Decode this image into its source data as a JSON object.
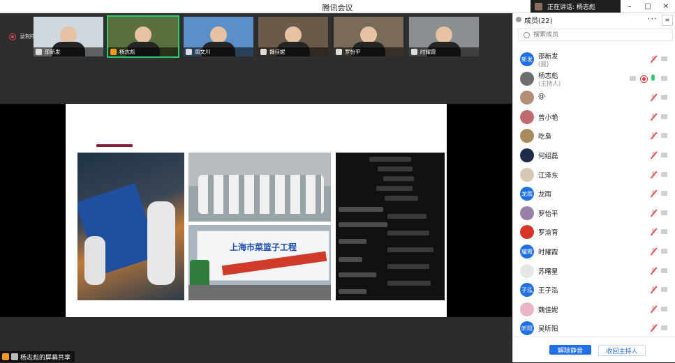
{
  "window": {
    "title": "腾讯会议",
    "speaking": "正在讲话: 杨志彪",
    "controls": {
      "minimize": "–",
      "maximize": "□",
      "close": "✕"
    }
  },
  "recording": {
    "label": "录制中"
  },
  "participants_strip": [
    {
      "name": "邵新发",
      "bg": "#cfd8de",
      "active": false
    },
    {
      "name": "杨志彪",
      "bg": "#5a6f3c",
      "active": true
    },
    {
      "name": "周文川",
      "bg": "#5b8fc7",
      "active": false
    },
    {
      "name": "魏佳妮",
      "bg": "#6b5a4a",
      "active": false
    },
    {
      "name": "罗怡平",
      "bg": "#7a6a5a",
      "active": false
    },
    {
      "name": "时耀霞",
      "bg": "#8a8f92",
      "active": false
    }
  ],
  "slide": {
    "truck_text": "上海市菜篮子工程"
  },
  "screen_share": {
    "label": "杨志彪的屏幕共享"
  },
  "members_panel": {
    "title": "成员(22)",
    "more": "···",
    "close": "≡",
    "search_placeholder": "搜索成员",
    "members": [
      {
        "name": "邵新发",
        "role": "(我)",
        "avatar_text": "新发",
        "color": "#1f6fe5"
      },
      {
        "name": "杨志彪",
        "role": "(主持人)",
        "avatar_text": "",
        "color": "#6d6d6d",
        "host": true
      },
      {
        "name": "@",
        "avatar_text": "",
        "color": "#b58e78"
      },
      {
        "name": "曾小艳",
        "avatar_text": "",
        "color": "#c06a70"
      },
      {
        "name": "吃枭",
        "avatar_text": "",
        "color": "#a88a5c"
      },
      {
        "name": "何绍磊",
        "avatar_text": "",
        "color": "#1d2b4a"
      },
      {
        "name": "江泽东",
        "avatar_text": "",
        "color": "#d9c7b8"
      },
      {
        "name": "龙雨",
        "avatar_text": "龙雨",
        "color": "#1f6fe5"
      },
      {
        "name": "罗怡平",
        "avatar_text": "",
        "color": "#9a7fa8"
      },
      {
        "name": "罗渝育",
        "avatar_text": "",
        "color": "#d8352a"
      },
      {
        "name": "时耀霞",
        "avatar_text": "耀霞",
        "color": "#1f6fe5"
      },
      {
        "name": "苏曙星",
        "avatar_text": "",
        "color": "#e6e6e6"
      },
      {
        "name": "王子泓",
        "avatar_text": "子泓",
        "color": "#1f6fe5"
      },
      {
        "name": "魏佳妮",
        "avatar_text": "",
        "color": "#e8b4c6"
      },
      {
        "name": "吴昕阳",
        "avatar_text": "昕阳",
        "color": "#1f6fe5"
      }
    ],
    "unmute_all": "解除静音",
    "reclaim_host": "收回主持人"
  }
}
